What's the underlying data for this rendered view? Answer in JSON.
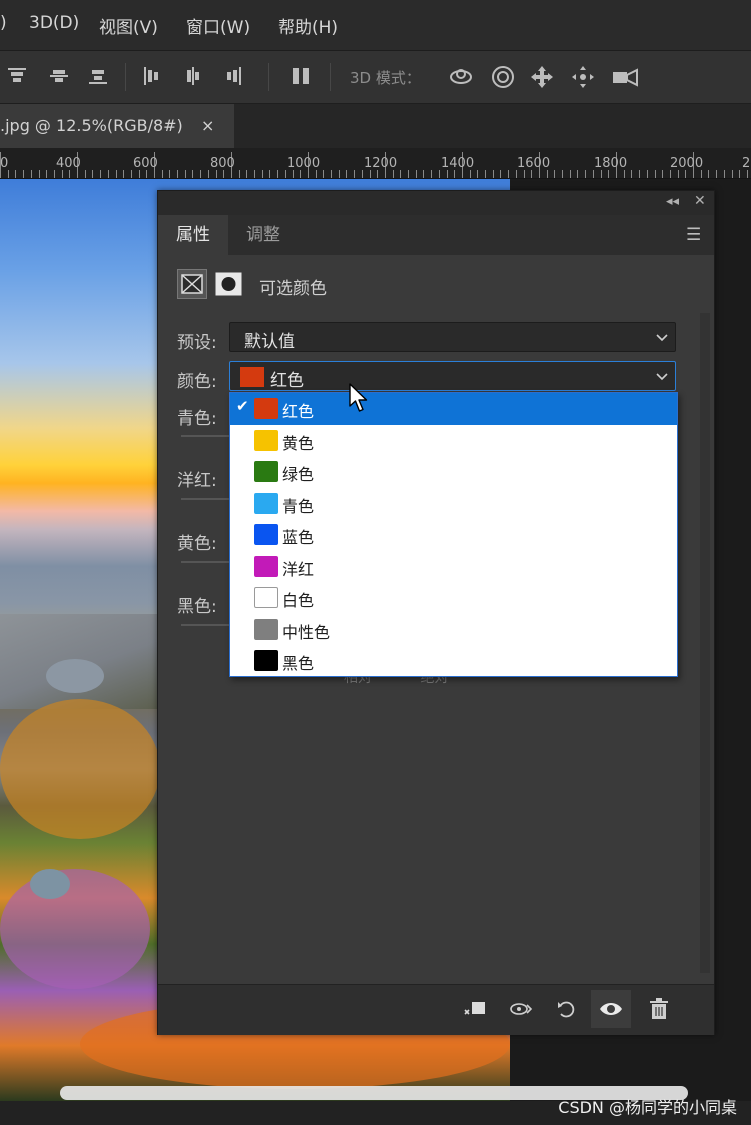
{
  "menubar": {
    "items": [
      ")",
      "3D(D)",
      "视图(V)",
      "窗口(W)",
      "帮助(H)"
    ]
  },
  "options_bar": {
    "mode_label": "3D 模式："
  },
  "document_tab": {
    "title": ".jpg @ 12.5%(RGB/8#)",
    "close_symbol": "×"
  },
  "ruler": {
    "labels": [
      "0",
      "400",
      "600",
      "800",
      "1000",
      "1200",
      "1400",
      "1600",
      "1800",
      "2000",
      "2"
    ]
  },
  "properties_panel": {
    "tabs": [
      "属性",
      "调整"
    ],
    "active_tab": "属性",
    "adjustment_title": "可选颜色",
    "preset_label": "预设:",
    "preset_value": "默认值",
    "color_label": "颜色:",
    "color_value": "红色",
    "selected_color_hex": "#d43a0f",
    "slider_labels": [
      "青色:",
      "洋红:",
      "黄色:",
      "黑色:"
    ],
    "radio_labels_obscured": [
      "相对",
      "绝对"
    ]
  },
  "color_dropdown": {
    "selected_index": 0,
    "options": [
      {
        "label": "红色",
        "color": "#d43a0f"
      },
      {
        "label": "黄色",
        "color": "#f6c200"
      },
      {
        "label": "绿色",
        "color": "#2a7a12"
      },
      {
        "label": "青色",
        "color": "#2aa9f0"
      },
      {
        "label": "蓝色",
        "color": "#0a55f0"
      },
      {
        "label": "洋红",
        "color": "#c21ab8"
      },
      {
        "label": "白色",
        "color": "#ffffff"
      },
      {
        "label": "中性色",
        "color": "#7f7f7f"
      },
      {
        "label": "黑色",
        "color": "#000000"
      }
    ]
  },
  "watermark": "CSDN @杨同学的小同桌",
  "accent_color": "#0f73d6"
}
